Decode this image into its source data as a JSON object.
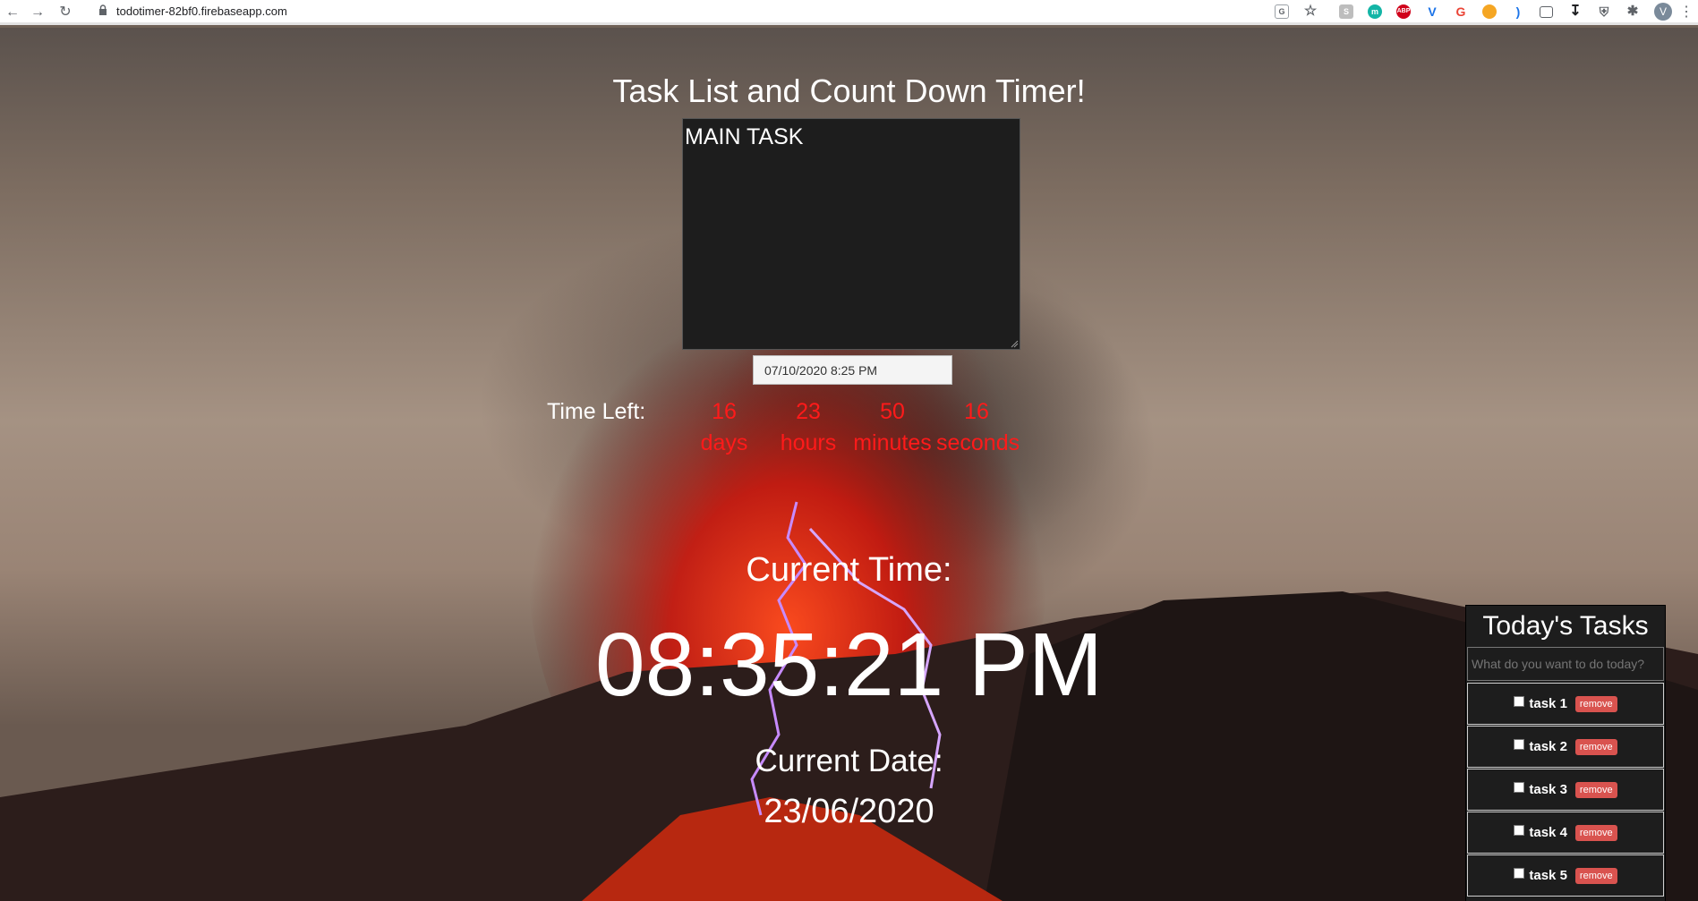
{
  "browser": {
    "url": "todotimer-82bf0.firebaseapp.com",
    "profile_initial": "V",
    "ext_abp": "ABP",
    "ext_m": "m"
  },
  "page": {
    "title": "Task List and Count Down Timer!",
    "main_task_value": "MAIN TASK",
    "datetime_value": "07/10/2020 8:25 PM",
    "time_left_label": "Time Left:",
    "countdown": [
      {
        "value": "16",
        "unit": "days"
      },
      {
        "value": "23",
        "unit": "hours"
      },
      {
        "value": "50",
        "unit": "minutes"
      },
      {
        "value": "16",
        "unit": "seconds"
      }
    ],
    "current_time_label": "Current Time:",
    "current_time": "08:35:21 PM",
    "current_date_label": "Current Date:",
    "current_date": "23/06/2020"
  },
  "tasks_panel": {
    "title": "Today's Tasks",
    "input_placeholder": "What do you want to do today?",
    "remove_label": "remove",
    "items": [
      {
        "label": "task 1"
      },
      {
        "label": "task 2"
      },
      {
        "label": "task 3"
      },
      {
        "label": "task 4"
      },
      {
        "label": "task 5"
      }
    ]
  }
}
